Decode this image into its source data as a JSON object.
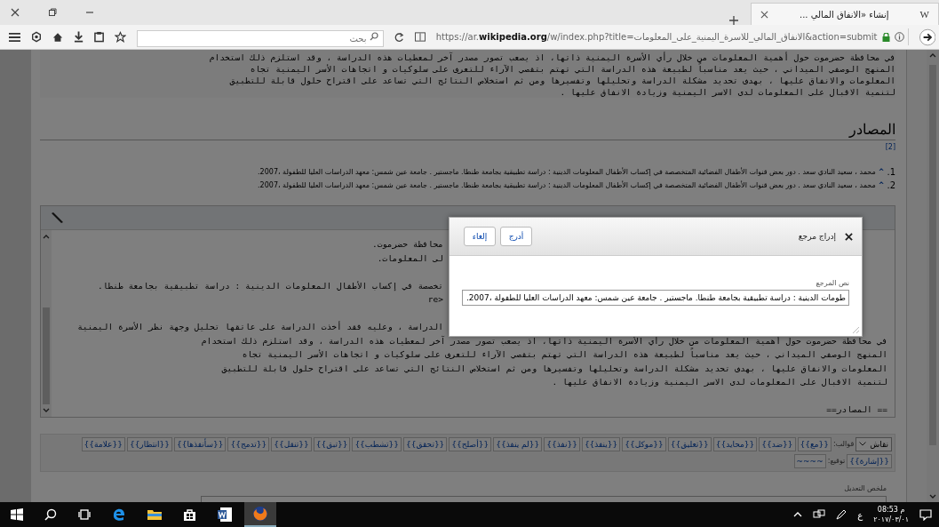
{
  "browser": {
    "tab_icon": "W",
    "tab_title": "إنشاء «الانفاق المالي ...",
    "url": "https://ar.**wikipedia.org**/w/index.php?title=الانفاق_المالي_للاسرة_اليمنية_على_المعلومات&action=submit",
    "search_placeholder": "بحث"
  },
  "article": {
    "paragraph_lines": [
      "في محافظة حضرموت حول أهمية المعلومات من خلال رأي الأسرة اليمنية ذاتها، اذ يصعب تصور مصدر آخر لمعطيات هذه الدراسة ، وقد استلزم ذلك استخدام",
      "المنهج الوصفي الميداني ، حيث يعد مناسباً لطبيعة هذه الدراسة التي تهتم بتقصي الآراء للتعرف على سلوكيات و اتجاهات الأسر اليمنية تجاه",
      "المعلومات والانفاق عليها ، بهدف تحديد مشكلة الدراسة وتحليلها وتفسيرها ومن ثم استخلاص النتائج التي تساعد على اقتراح حلول قابلة للتطبيق",
      "لتنمية الاقبال على المعلومات لدى الاسر اليمنية وزيادة الانفاق عليها ."
    ],
    "heading": "المصادر",
    "edit_link": "[2]",
    "references": [
      {
        "number": "1.",
        "caret": "^",
        "text": "محمد ، سعيد النادي سعد . دور بعض قنوات الأطفال الفضائية المتخصصة في إكساب الأطفال المعلومات الدينية : دراسة تطبيقية بجامعة طنطا. ماجستير . جامعة عين شمس: معهد الدراسات العليا للطفولة ،2007."
      },
      {
        "number": "2.",
        "caret": "^",
        "text": "محمد ، سعيد النادي سعد . دور بعض قنوات الأطفال الفضائية المتخصصة في إكساب الأطفال المعلومات الدينية : دراسة تطبيقية بجامعة طنطا. ماجستير . جامعة عين شمس: معهد الدراسات العليا للطفولة ،2007."
      }
    ]
  },
  "editor": {
    "lines": [
      {
        "kind": "covered",
        "text": "محافظة حضرموت."
      },
      {
        "kind": "covered",
        "text": "لى المعلومات."
      },
      {
        "kind": "blank"
      },
      {
        "kind": "covered",
        "text": "تخصصة في إكساب الأطفال المعلومات الدينية : دراسة تطبيقية بجامعة طنطا."
      },
      {
        "kind": "covered",
        "text": "<re"
      },
      {
        "kind": "blank"
      },
      {
        "kind": "covered",
        "text": "الدراسة ، وعليه فقد أخذت الدراسة على عاتقها تحليل وجهة نظر الأسرة اليمنية"
      },
      {
        "kind": "full",
        "text": "في محافظة حضرموت حول أهمية المعلومات من خلال رأي الأسرة اليمنية ذاتها، اذ يصعب تصور مصدر آخر لمعطيات هذه الدراسة ، وقد استلزم ذلك استخدام"
      },
      {
        "kind": "full",
        "text": "المنهج الوصفي الميداني ، حيث يعد مناسباً لطبيعة هذه الدراسة التي تهتم بتقصي الآراء للتعرف على سلوكيات و اتجاهات الأسر اليمنية تجاه"
      },
      {
        "kind": "full",
        "text": "المعلومات والانفاق عليها ، بهدف تحديد مشكلة الدراسة وتحليلها وتفسيرها ومن ثم استخلاص النتائج التي تساعد على اقتراح حلول قابلة للتطبيق"
      },
      {
        "kind": "full",
        "text": "لتنمية الاقبال على المعلومات لدى الاسر اليمنية وزيادة الانفاق عليها ."
      },
      {
        "kind": "blank"
      },
      {
        "kind": "full",
        "text": "== المصادر=="
      }
    ],
    "talk_select": "نقاش",
    "templates_label": "قوالب:",
    "templates": [
      "{{مع}}",
      "{{ضد}}",
      "{{محايد}}",
      "{{تعليق}}",
      "{{موكل}}",
      "{{ينفذ}}",
      "{{نفذ}}",
      "{{لم ينفذ}}",
      "{{أصلح}}",
      "{{تحقق}}",
      "{{تشطب}}",
      "{{تبق}}",
      "{{تنقل}}",
      "{{تدمج}}",
      "{{سأنفذها}}",
      "{{انتظار}}",
      "{{علامة}}",
      "{{إشارة}}"
    ],
    "signature_label": "توقيع:",
    "signature": "~~~~",
    "summary_label": "ملخص التعديل"
  },
  "dialog": {
    "title": "إدراج مرجع",
    "buttons": [
      "أدرج",
      "إلغاء"
    ],
    "field_label": "نص المرجع",
    "field_value": "طومات الدينية : دراسة تطبيقية بجامعة طنطا. ماجستير . جامعة عين شمس: معهد الدراسات العليا للطفولة ،2007."
  },
  "taskbar": {
    "language": "ع",
    "time": "08:53 م",
    "date": "٢٠١٧/٠٣/٠١"
  }
}
